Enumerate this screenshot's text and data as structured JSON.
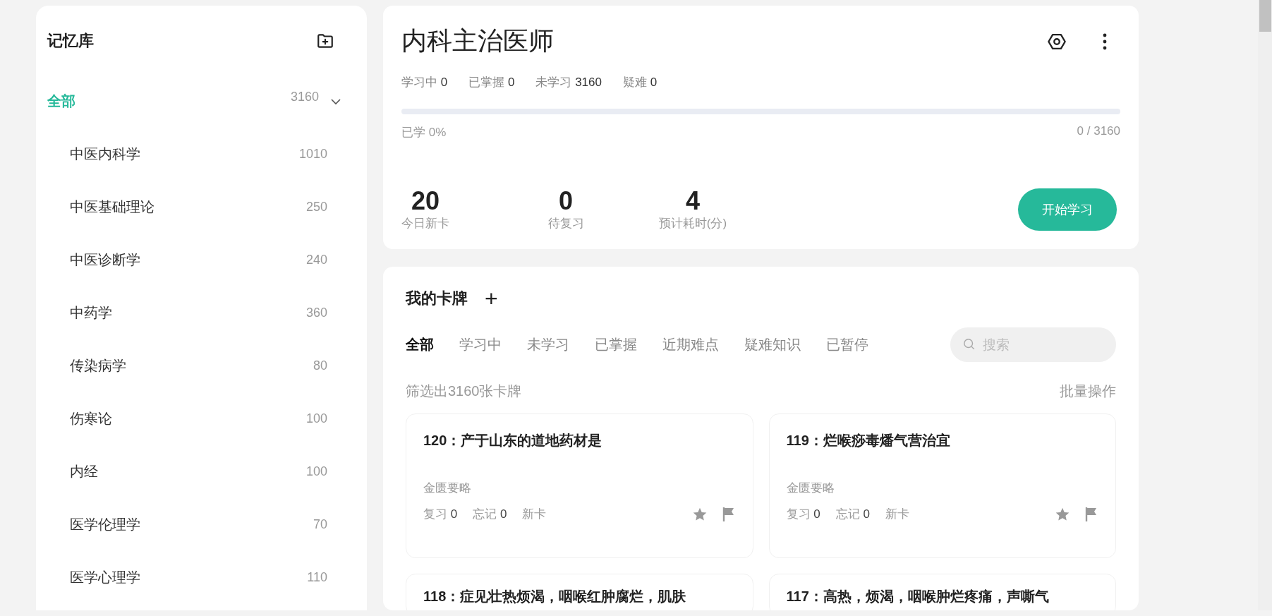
{
  "sidebar": {
    "title": "记忆库",
    "tree": [
      {
        "label": "全部",
        "count": "3160",
        "selected": true,
        "expanded": true,
        "children": [
          {
            "label": "中医内科学",
            "count": "1010",
            "selected": false
          },
          {
            "label": "中医基础理论",
            "count": "250",
            "selected": false
          },
          {
            "label": "中医诊断学",
            "count": "240",
            "selected": false
          },
          {
            "label": "中药学",
            "count": "360",
            "selected": false
          },
          {
            "label": "传染病学",
            "count": "80",
            "selected": false
          },
          {
            "label": "伤寒论",
            "count": "100",
            "selected": false
          },
          {
            "label": "内经",
            "count": "100",
            "selected": false
          },
          {
            "label": "医学伦理学",
            "count": "70",
            "selected": false
          },
          {
            "label": "医学心理学",
            "count": "110",
            "selected": false
          }
        ]
      }
    ]
  },
  "deck": {
    "title": "内科主治医师",
    "stats": [
      {
        "label": "学习中",
        "value": "0"
      },
      {
        "label": "已掌握",
        "value": "0"
      },
      {
        "label": "未学习",
        "value": "3160"
      },
      {
        "label": "疑难",
        "value": "0"
      }
    ],
    "progress": {
      "label": "已学 0%",
      "reading": "0 / 3160"
    },
    "summary": [
      {
        "value": "20",
        "label": "今日新卡"
      },
      {
        "value": "0",
        "label": "待复习"
      },
      {
        "value": "4",
        "label": "预计耗时(分)"
      }
    ],
    "start_button": "开始学习"
  },
  "cards_panel": {
    "title": "我的卡牌",
    "add_symbol": "+",
    "tabs": [
      {
        "label": "全部",
        "selected": true
      },
      {
        "label": "学习中",
        "selected": false
      },
      {
        "label": "未学习",
        "selected": false
      },
      {
        "label": "已掌握",
        "selected": false
      },
      {
        "label": "近期难点",
        "selected": false
      },
      {
        "label": "疑难知识",
        "selected": false
      },
      {
        "label": "已暂停",
        "selected": false
      }
    ],
    "search": {
      "placeholder": "搜索"
    },
    "filter_text": "筛选出3160张卡牌",
    "batch_action": "批量操作",
    "cards": [
      {
        "title": "120：产于山东的道地药材是",
        "category": "金匮要略",
        "review": "复习",
        "review_count": "0",
        "forget": "忘记",
        "forget_count": "0",
        "status": "新卡"
      },
      {
        "title": "119：烂喉痧毒燔气营治宜",
        "category": "金匮要略",
        "review": "复习",
        "review_count": "0",
        "forget": "忘记",
        "forget_count": "0",
        "status": "新卡"
      },
      {
        "title": "118：症见壮热烦渴，咽喉红肿腐烂，肌肤"
      },
      {
        "title": "117：高热，烦渴，咽喉肿烂疼痛，声嘶气"
      }
    ]
  }
}
